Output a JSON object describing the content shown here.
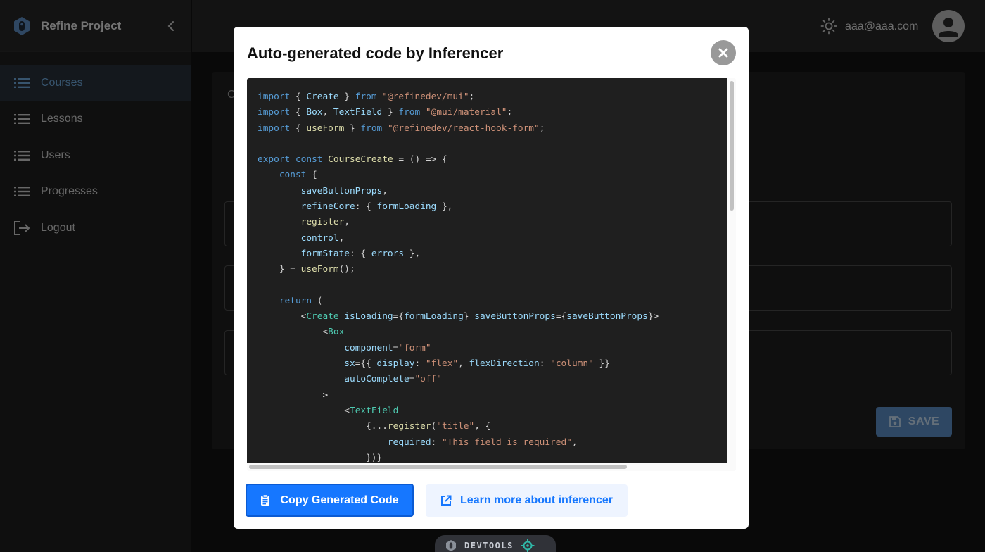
{
  "app": {
    "title": "Refine Project"
  },
  "sidebar": {
    "items": [
      {
        "label": "Courses",
        "icon": "list-icon",
        "active": true
      },
      {
        "label": "Lessons",
        "icon": "list-icon",
        "active": false
      },
      {
        "label": "Users",
        "icon": "list-icon",
        "active": false
      },
      {
        "label": "Progresses",
        "icon": "list-icon",
        "active": false
      },
      {
        "label": "Logout",
        "icon": "logout-icon",
        "active": false
      }
    ]
  },
  "header": {
    "user_email": "aaa@aaa.com",
    "theme_icon": "sun-icon",
    "avatar_icon": "person-icon"
  },
  "page": {
    "card_title_partial": "C",
    "save_label": "SAVE"
  },
  "modal": {
    "title": "Auto-generated code by Inferencer",
    "copy_label": "Copy Generated Code",
    "learn_label": "Learn more about inferencer",
    "code_lines": [
      "import { Create } from \"@refinedev/mui\";",
      "import { Box, TextField } from \"@mui/material\";",
      "import { useForm } from \"@refinedev/react-hook-form\";",
      "",
      "export const CourseCreate = () => {",
      "    const {",
      "        saveButtonProps,",
      "        refineCore: { formLoading },",
      "        register,",
      "        control,",
      "        formState: { errors },",
      "    } = useForm();",
      "",
      "    return (",
      "        <Create isLoading={formLoading} saveButtonProps={saveButtonProps}>",
      "            <Box",
      "                component=\"form\"",
      "                sx={{ display: \"flex\", flexDirection: \"column\" }}",
      "                autoComplete=\"off\"",
      "            >",
      "                <TextField",
      "                    {...register(\"title\", {",
      "                        required: \"This field is required\",",
      "                    })}"
    ]
  },
  "devtools": {
    "label": "DEVTOOLS"
  },
  "colors": {
    "accent": "#1677ff",
    "active_nav": "#6ea8dc",
    "save_button": "#5d8fc7"
  }
}
